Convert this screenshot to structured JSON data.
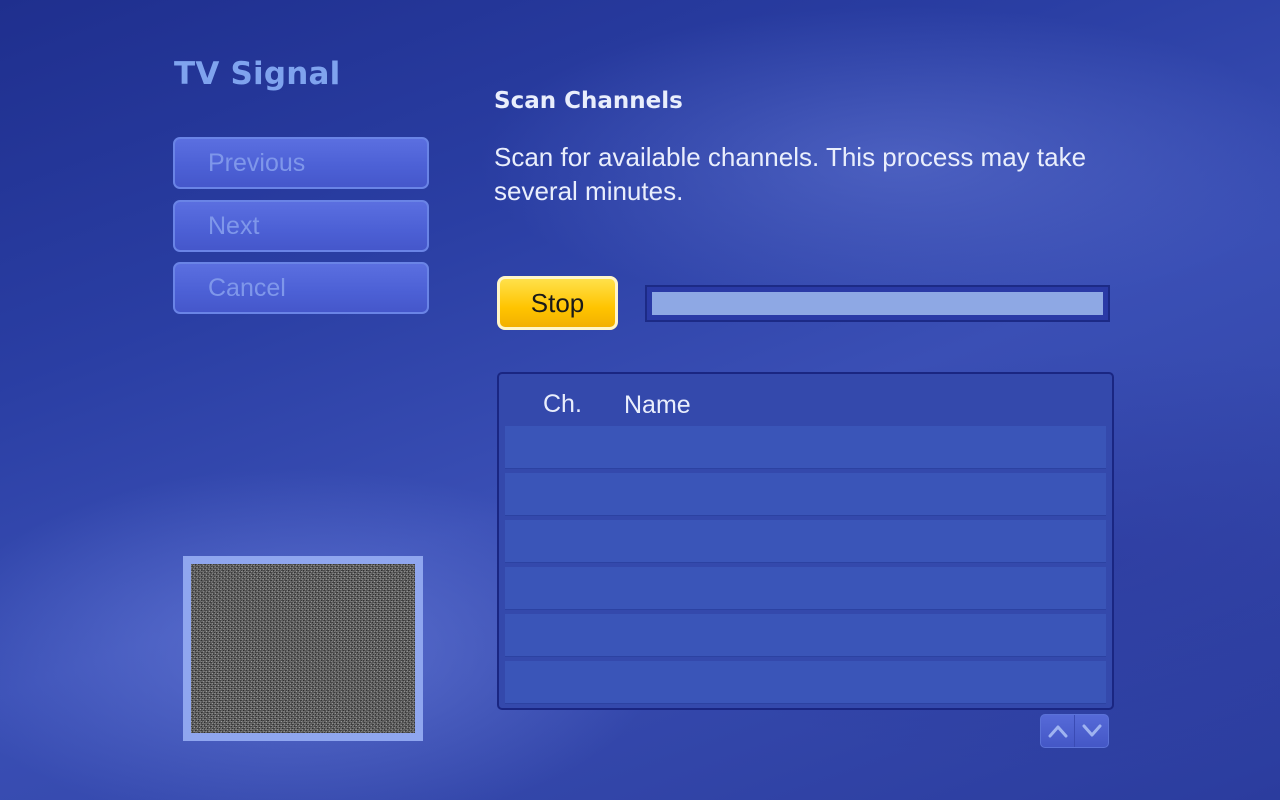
{
  "page": {
    "title": "TV Signal"
  },
  "nav": {
    "previous_label": "Previous",
    "next_label": "Next",
    "cancel_label": "Cancel"
  },
  "main": {
    "heading": "Scan Channels",
    "description": "Scan for available channels. This process may take several minutes.",
    "stop_label": "Stop",
    "progress_fraction": 0.0
  },
  "channel_list": {
    "columns": [
      "Ch.",
      "Name"
    ],
    "rows": [
      {
        "ch": "",
        "name": ""
      },
      {
        "ch": "",
        "name": ""
      },
      {
        "ch": "",
        "name": ""
      },
      {
        "ch": "",
        "name": ""
      },
      {
        "ch": "",
        "name": ""
      },
      {
        "ch": "",
        "name": ""
      }
    ]
  },
  "icons": {
    "scroll_up": "chevron-up-icon",
    "scroll_down": "chevron-down-icon"
  },
  "colors": {
    "accent_button": "#ffc400",
    "title": "#7fa3ee",
    "text": "#e9eefc"
  }
}
